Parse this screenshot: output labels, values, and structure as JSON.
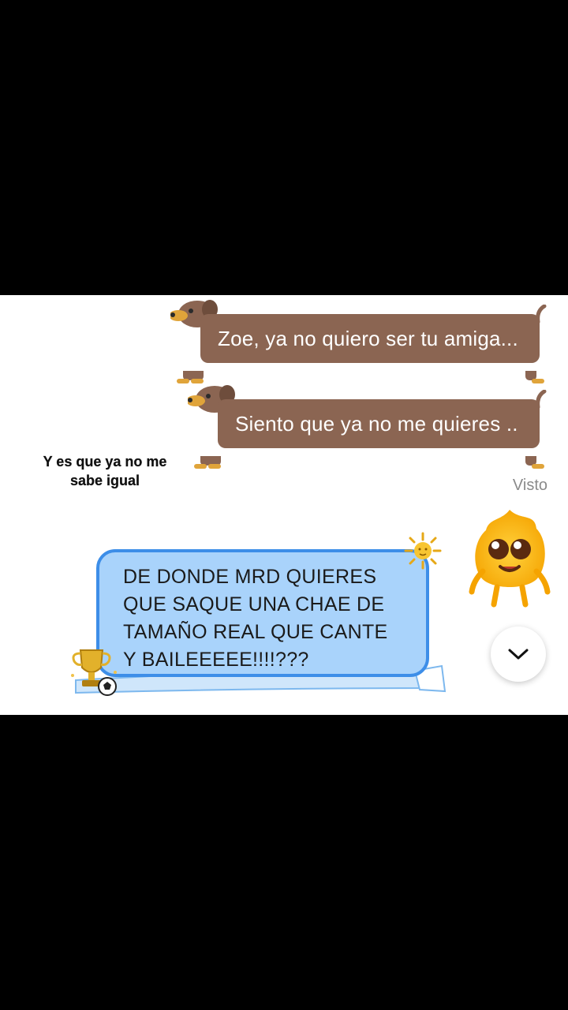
{
  "messages": [
    {
      "text": "Zoe, ya no quiero ser tu amiga..."
    },
    {
      "text": "Siento que ya no me quieres .."
    }
  ],
  "overlay_caption_line1": "Y es que ya no me",
  "overlay_caption_line2": "sabe igual",
  "seen_status": "Visto",
  "reply": {
    "line1": "DE DONDE MRD QUIERES",
    "line2": "QUE SAQUE UNA CHAE DE",
    "line3": "TAMAÑO REAL QUE CANTE",
    "line4": "Y BAILEEEEE!!!!???"
  },
  "icons": {
    "mascot": "yellow-flame-mascot-icon",
    "sun": "argentina-sun-icon",
    "trophy": "trophy-soccer-ball-icon",
    "scroll": "chevron-down-icon"
  },
  "colors": {
    "dog_bubble": "#8b6552",
    "blue_bubble_fill": "#a9d3fb",
    "blue_bubble_border": "#3d8ee8",
    "seen_text": "#8a8a8a"
  }
}
